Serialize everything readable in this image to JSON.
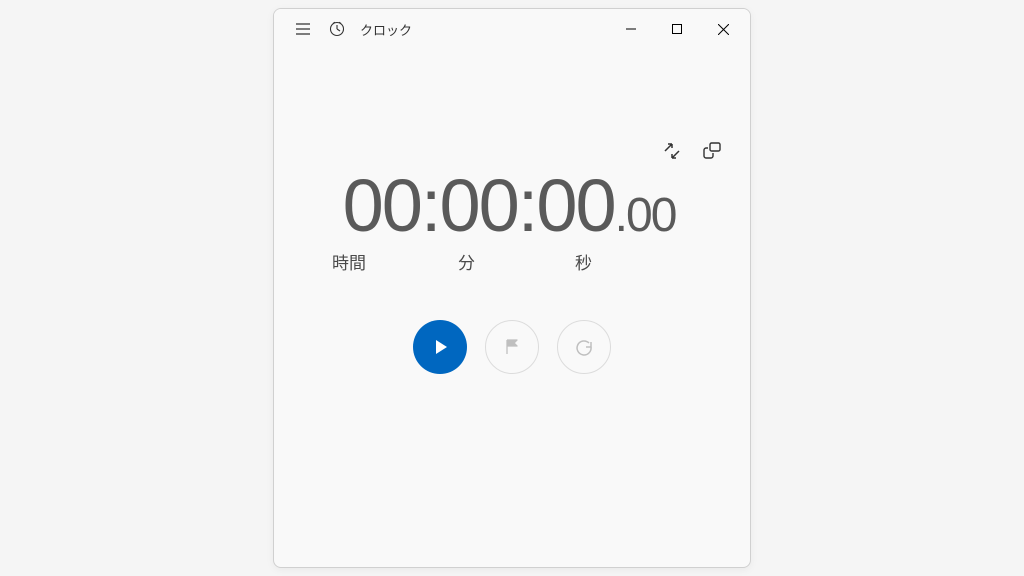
{
  "app": {
    "title": "クロック"
  },
  "time": {
    "hours": "00",
    "minutes": "00",
    "seconds": "00",
    "centiseconds": "00",
    "sep": ":",
    "dot": "."
  },
  "labels": {
    "hours": "時間",
    "minutes": "分",
    "seconds": "秒"
  }
}
